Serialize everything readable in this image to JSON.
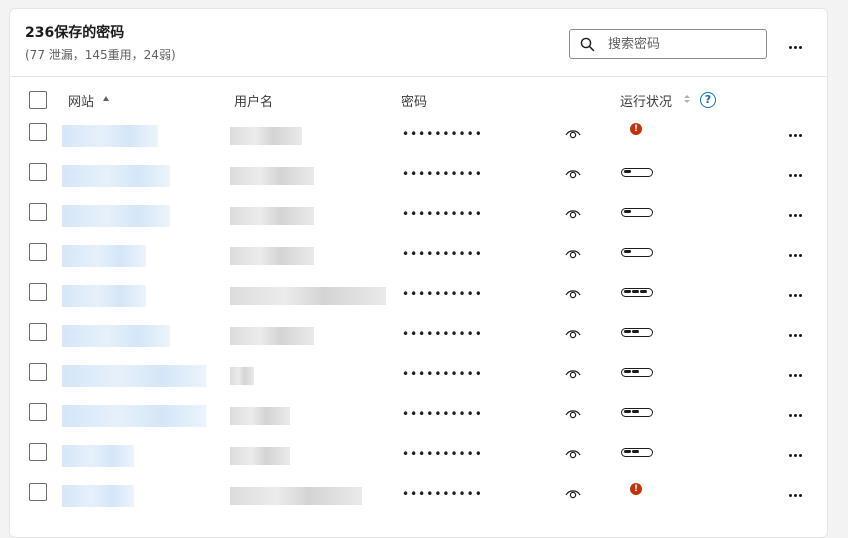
{
  "header": {
    "title": "236保存的密码",
    "subtitle": "(77 泄漏，145重用，24弱)"
  },
  "search": {
    "placeholder": "搜索密码",
    "value": ""
  },
  "columns": {
    "site": "网站",
    "username": "用户名",
    "password": "密码",
    "health": "运行状况"
  },
  "help_glyph": "?",
  "warn_glyph": "!",
  "colors": {
    "warning": "#c4320a",
    "accent": "#0f6cbd",
    "blur_site": "#cfe3f7",
    "blur_user": "#dcdcdc"
  },
  "icons": {
    "search": "search-icon",
    "more": "more-options-icon",
    "eye": "eye-icon",
    "help": "help-icon",
    "warning": "warning-icon"
  },
  "rows": [
    {
      "password_mask": "••••••••••",
      "health": "warning"
    },
    {
      "password_mask": "••••••••••",
      "health_level": 1
    },
    {
      "password_mask": "••••••••••",
      "health_level": 1
    },
    {
      "password_mask": "••••••••••",
      "health_level": 1
    },
    {
      "password_mask": "••••••••••",
      "health_level": 3
    },
    {
      "password_mask": "••••••••••",
      "health_level": 2
    },
    {
      "password_mask": "••••••••••",
      "health_level": 2
    },
    {
      "password_mask": "••••••••••",
      "health_level": 2
    },
    {
      "password_mask": "••••••••••",
      "health_level": 2
    },
    {
      "password_mask": "••••••••••",
      "health": "warning"
    }
  ]
}
